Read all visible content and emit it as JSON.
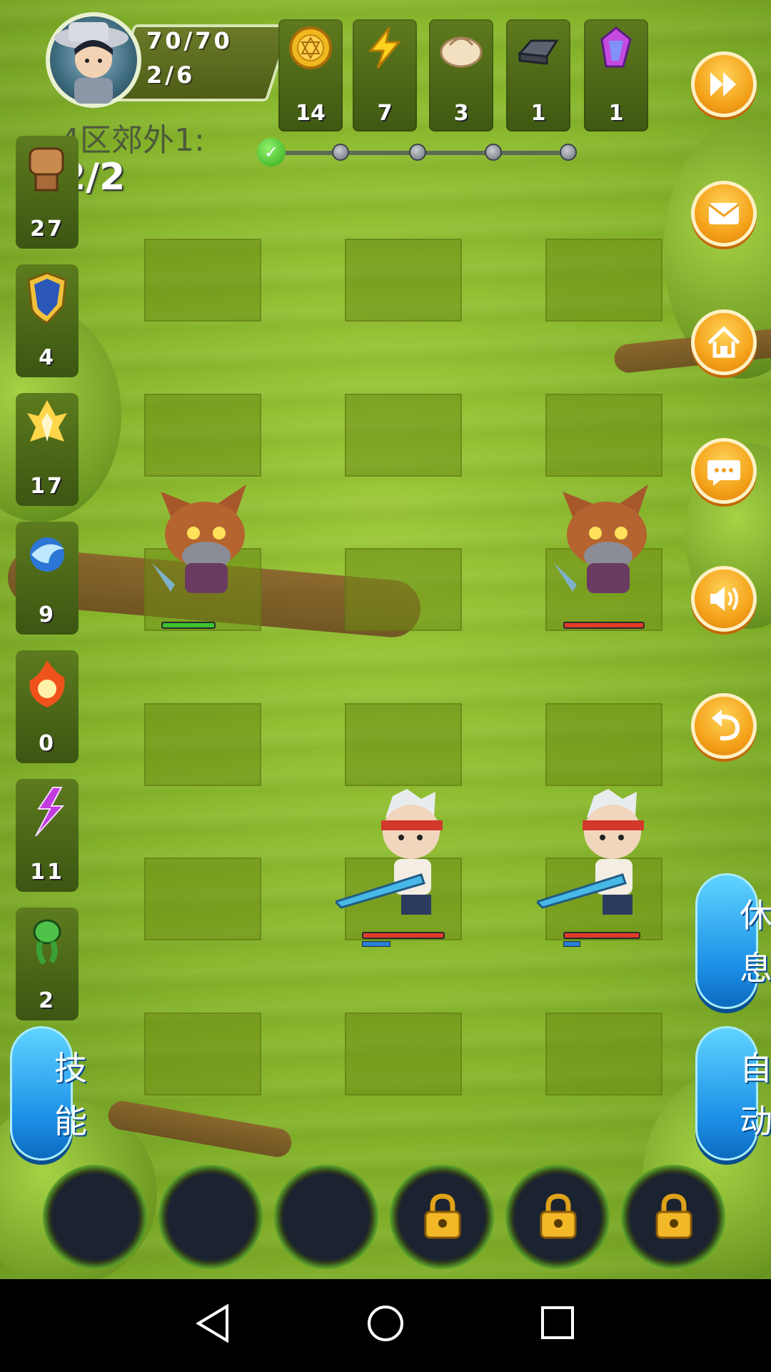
{
  "hud": {
    "hp": "70/70",
    "energy": "2/6"
  },
  "resources": [
    {
      "name": "gold-coin-icon",
      "count": "14"
    },
    {
      "name": "lightning-icon",
      "count": "7"
    },
    {
      "name": "dumpling-icon",
      "count": "3"
    },
    {
      "name": "iron-ingot-icon",
      "count": "1"
    },
    {
      "name": "crystal-icon",
      "count": "1"
    }
  ],
  "stage": {
    "title": "4区郊外1:",
    "wave": "2/2",
    "progress_nodes": 5,
    "completed_nodes": 1
  },
  "skills": [
    {
      "name": "fist-icon",
      "value": "27"
    },
    {
      "name": "shield-icon",
      "value": "4"
    },
    {
      "name": "holy-light-icon",
      "value": "17"
    },
    {
      "name": "water-orb-icon",
      "value": "9"
    },
    {
      "name": "fire-icon",
      "value": "0"
    },
    {
      "name": "lightning-rune-icon",
      "value": "11"
    },
    {
      "name": "poison-icon",
      "value": "2"
    }
  ],
  "right_buttons": [
    "fast-forward-icon",
    "mail-icon",
    "home-icon",
    "chat-icon",
    "sound-icon",
    "return-icon"
  ],
  "buttons": {
    "skill_1": "技",
    "skill_2": "能",
    "rest_1": "休",
    "rest_2": "息",
    "auto_1": "自",
    "auto_2": "动"
  },
  "units": {
    "wolf_left": {
      "hp_color": "#3cc42e",
      "hp": 1.0
    },
    "wolf_right": {
      "hp_color": "#e33b2b",
      "hp": 1.0
    },
    "hero_mid": {
      "hp_color": "#e33b2b",
      "hp": 1.0,
      "mp": 0.3
    },
    "hero_right": {
      "hp_color": "#e33b2b",
      "hp": 1.0,
      "mp": 0.2
    }
  },
  "slots": [
    {
      "locked": false
    },
    {
      "locked": false
    },
    {
      "locked": false
    },
    {
      "locked": true
    },
    {
      "locked": true
    },
    {
      "locked": true
    }
  ],
  "colors": {
    "accent_orange": "#f4a21a",
    "accent_blue": "#1b8fe6",
    "grass": "#86b52b"
  }
}
